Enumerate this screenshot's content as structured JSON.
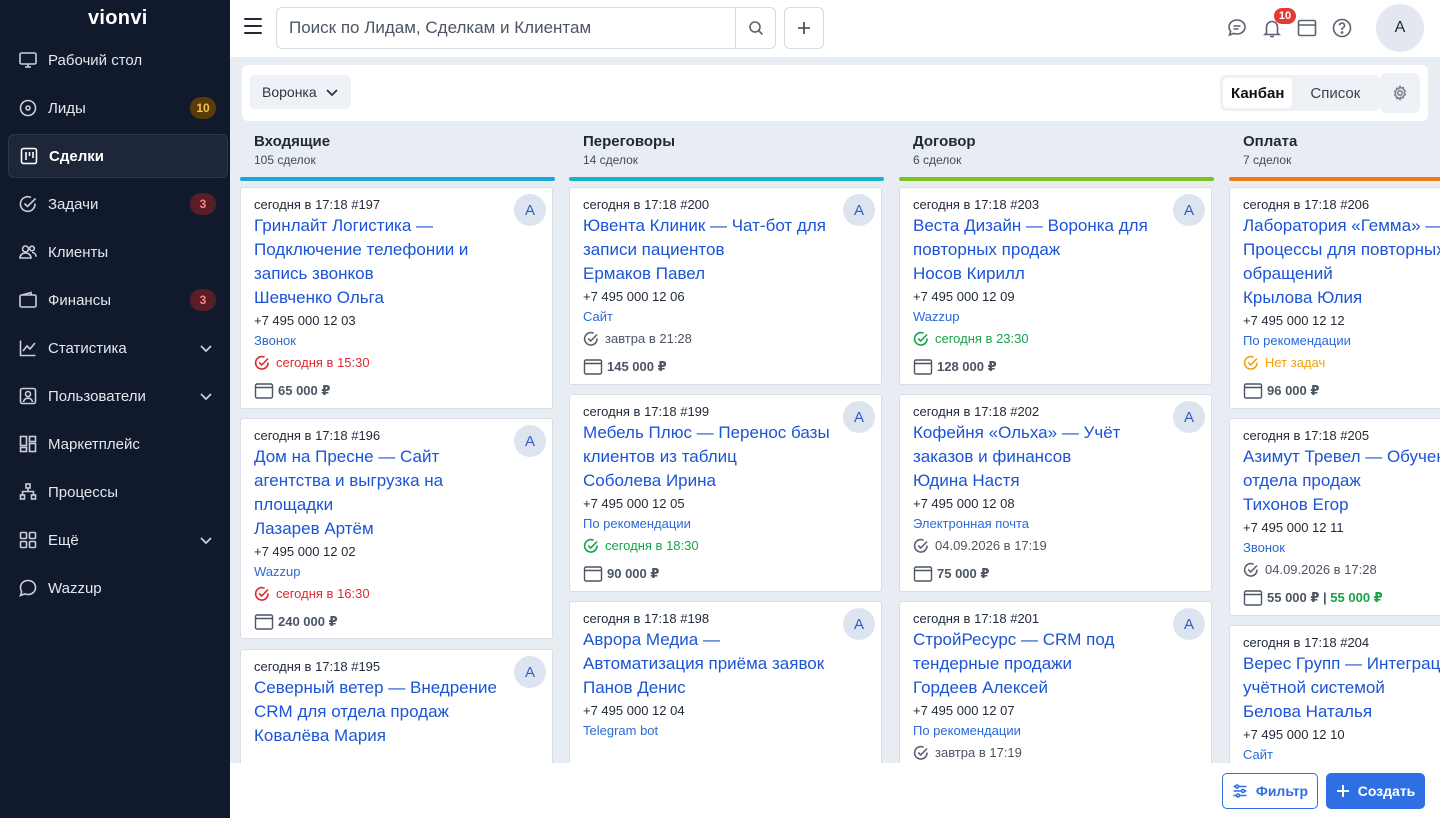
{
  "app": {
    "logo": "vionvi"
  },
  "sidebar": {
    "items": [
      {
        "label": "Рабочий стол",
        "icon": "monitor-icon"
      },
      {
        "label": "Лиды",
        "icon": "target-icon",
        "badge": "10"
      },
      {
        "label": "Сделки",
        "icon": "kanban-icon",
        "active": true
      },
      {
        "label": "Задачи",
        "icon": "check-circle-icon",
        "badge": "3"
      },
      {
        "label": "Клиенты",
        "icon": "users-icon"
      },
      {
        "label": "Финансы",
        "icon": "wallet-icon",
        "badge": "3"
      },
      {
        "label": "Статистика",
        "icon": "chart-icon",
        "expandable": true
      },
      {
        "label": "Пользователи",
        "icon": "user-card-icon",
        "expandable": true
      },
      {
        "label": "Маркетплейс",
        "icon": "grid-icon"
      },
      {
        "label": "Процессы",
        "icon": "flow-icon"
      },
      {
        "label": "Ещё",
        "icon": "apps-icon",
        "expandable": true
      },
      {
        "label": "Wazzup",
        "icon": "chat-icon"
      }
    ]
  },
  "topbar": {
    "search_placeholder": "Поиск по Лидам, Сделкам и Клиентам",
    "notifications_count": "10",
    "avatar_letter": "А"
  },
  "toolbar": {
    "funnel_label": "Воронка",
    "view_kanban": "Канбан",
    "view_list": "Список"
  },
  "columns": [
    {
      "title": "Входящие",
      "count": "105 сделок",
      "color": "#1aa6d9",
      "cards": [
        {
          "meta": "сегодня в 17:18 #197",
          "avatar": "А",
          "title": "Гринлайт Логистика — Подключение телефонии и запись звонков",
          "contact": "Шевченко Ольга",
          "phone": "+7 495 000 12 03",
          "source": "Звонок",
          "task": "сегодня в 15:30",
          "task_state": "red",
          "sum": "65 000 ₽"
        },
        {
          "meta": "сегодня в 17:18 #196",
          "avatar": "А",
          "title": "Дом на Пресне — Сайт агентства и выгрузка на площадки",
          "contact": "Лазарев Артём",
          "phone": "+7 495 000 12 02",
          "source": "Wazzup",
          "task": "сегодня в 16:30",
          "task_state": "red",
          "sum": "240 000 ₽"
        },
        {
          "meta": "сегодня в 17:18 #195",
          "avatar": "А",
          "title": "Северный ветер — Внедрение CRM для отдела продаж",
          "contact": "Ковалёва Мария",
          "phone": "",
          "source": "",
          "task": "",
          "task_state": "",
          "sum": ""
        }
      ]
    },
    {
      "title": "Переговоры",
      "count": "14 сделок",
      "color": "#17b3c9",
      "cards": [
        {
          "meta": "сегодня в 17:18 #200",
          "avatar": "А",
          "title": "Ювента Клиник — Чат-бот для записи пациентов",
          "contact": "Ермаков Павел",
          "phone": "+7 495 000 12 06",
          "source": "Сайт",
          "task": "завтра в 21:28",
          "task_state": "gray",
          "sum": "145 000 ₽"
        },
        {
          "meta": "сегодня в 17:18 #199",
          "avatar": "А",
          "title": "Мебель Плюс — Перенос базы клиентов из таблиц",
          "contact": "Соболева Ирина",
          "phone": "+7 495 000 12 05",
          "source": "По рекомендации",
          "task": "сегодня в 18:30",
          "task_state": "green",
          "sum": "90 000 ₽"
        },
        {
          "meta": "сегодня в 17:18 #198",
          "avatar": "А",
          "title": "Аврора Медиа — Автоматизация приёма заявок",
          "contact": "Панов Денис",
          "phone": "+7 495 000 12 04",
          "source": "Telegram bot",
          "task": "",
          "task_state": "",
          "sum": ""
        }
      ]
    },
    {
      "title": "Договор",
      "count": "6 сделок",
      "color": "#7cc21c",
      "cards": [
        {
          "meta": "сегодня в 17:18 #203",
          "avatar": "А",
          "title": "Веста Дизайн — Воронка для повторных продаж",
          "contact": "Носов Кирилл",
          "phone": "+7 495 000 12 09",
          "source": "Wazzup",
          "task": "сегодня в 23:30",
          "task_state": "green",
          "sum": "128 000 ₽"
        },
        {
          "meta": "сегодня в 17:18 #202",
          "avatar": "А",
          "title": "Кофейня «Ольха» — Учёт заказов и финансов",
          "contact": "Юдина Настя",
          "phone": "+7 495 000 12 08",
          "source": "Электронная почта",
          "task": "04.09.2026 в 17:19",
          "task_state": "gray",
          "sum": "75 000 ₽"
        },
        {
          "meta": "сегодня в 17:18 #201",
          "avatar": "А",
          "title": "СтройРесурс — CRM под тендерные продажи",
          "contact": "Гордеев Алексей",
          "phone": "+7 495 000 12 07",
          "source": "По рекомендации",
          "task": "завтра в 17:19",
          "task_state": "gray",
          "sum": ""
        }
      ]
    },
    {
      "title": "Оплата",
      "count": "7 сделок",
      "color": "#f27a1a",
      "cards": [
        {
          "meta": "сегодня в 17:18 #206",
          "avatar": "А",
          "title": "Лаборатория «Гемма» — Процессы для повторных обращений",
          "contact": "Крылова Юлия",
          "phone": "+7 495 000 12 12",
          "source": "По рекомендации",
          "task": "Нет задач",
          "task_state": "orange",
          "sum": "96 000 ₽"
        },
        {
          "meta": "сегодня в 17:18 #205",
          "avatar": "А",
          "title": "Азимут Тревел — Обучение отдела продаж",
          "contact": "Тихонов Егор",
          "phone": "+7 495 000 12 11",
          "source": "Звонок",
          "task": "04.09.2026 в 17:28",
          "task_state": "gray",
          "sum": "55 000 ₽",
          "sum_sep": " | ",
          "sum_paid": "55 000 ₽"
        },
        {
          "meta": "сегодня в 17:18 #204",
          "avatar": "А",
          "title": "Верес Групп — Интеграция с учётной системой",
          "contact": "Белова Наталья",
          "phone": "+7 495 000 12 10",
          "source": "Сайт",
          "task": "",
          "task_state": "",
          "sum": ""
        }
      ]
    }
  ],
  "bottombar": {
    "filter_label": "Фильтр",
    "create_label": "Создать"
  }
}
